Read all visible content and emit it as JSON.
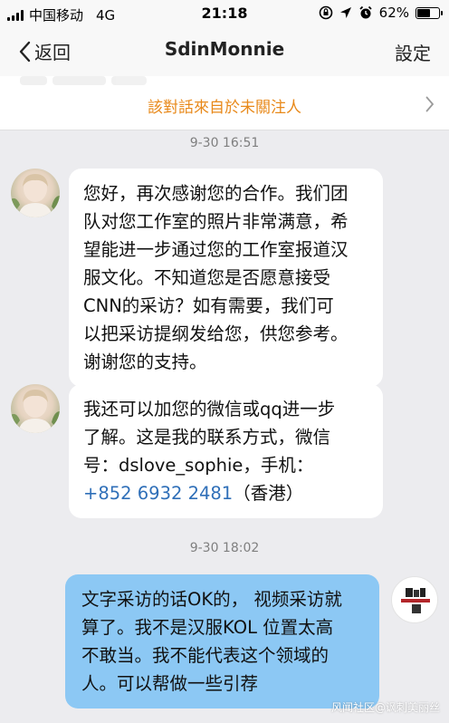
{
  "status_bar": {
    "carrier": "中国移动",
    "network": "4G",
    "time": "21:18",
    "battery_percent": "62%",
    "battery_level": 0.62
  },
  "nav": {
    "back_label": "返回",
    "title": "SdinMonnie",
    "settings_label": "設定"
  },
  "notice": {
    "text": "該對話來自於未關注人"
  },
  "messages": {
    "timestamp_1": "9-30 16:51",
    "msg_1_lines": [
      "您好，再次感谢您的合作。我们团",
      "队对您工作室的照片非常满意，希",
      "望能进一步通过您的工作室报道汉",
      "服文化。不知道您是否愿意接受",
      "CNN的采访？如有需要，我们可",
      "以把采访提纲发给您，供您参考。",
      "谢谢您的支持。"
    ],
    "msg_2_lines": [
      "我还可以加您的微信或qq进一步",
      "了解。这是我的联系方式，微信",
      "号：dslove_sophie，手机："
    ],
    "msg_2_phone": "+852 6932 2481",
    "msg_2_phone_suffix": "（香港）",
    "timestamp_2": "9-30 18:02",
    "msg_3_lines": [
      "文字采访的话OK的， 视频采访就",
      "算了。我不是汉服KOL 位置太高",
      "不敢当。我不能代表这个领域的",
      "人。可以帮做一些引荐"
    ]
  },
  "watermark": "风闻社区@讽刺美丽丝",
  "colors": {
    "background": "#ececef",
    "notice_text": "#e8891a",
    "outgoing_bubble": "#8cc8f4",
    "phone_link": "#2f6fb8"
  },
  "icons": [
    "signal-icon",
    "back-chevron-icon",
    "chevron-right-icon",
    "orientation-lock-icon",
    "location-icon",
    "alarm-icon",
    "battery-icon",
    "avatar-icon"
  ]
}
